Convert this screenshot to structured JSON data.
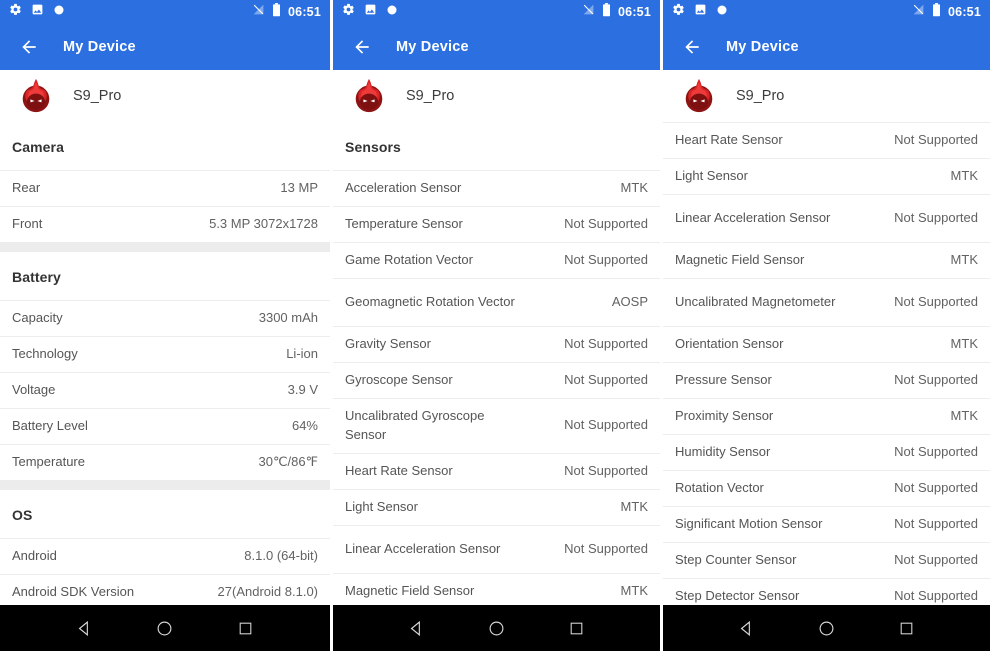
{
  "statusbar": {
    "icons": [
      "gear-icon",
      "image-icon",
      "circle-icon"
    ],
    "signal_icon": "signal-off-icon",
    "battery_icon": "battery-icon",
    "time": "06:51"
  },
  "appbar": {
    "back_icon": "back-arrow-icon",
    "title": "My Device"
  },
  "device": {
    "logo_icon": "antutu-logo-icon",
    "name": "S9_Pro"
  },
  "navbar": {
    "back_icon": "nav-back-triangle-icon",
    "home_icon": "nav-home-circle-icon",
    "recents_icon": "nav-recents-square-icon"
  },
  "colors": {
    "accent_blue": "#2B6FE0",
    "band_gray": "#ececec",
    "divider": "#ededed",
    "label": "#555555",
    "value": "#626262",
    "navbar_black": "#000000"
  },
  "panel1": {
    "sections": [
      {
        "title": "Camera",
        "band_before": false,
        "rows": [
          {
            "label": "Rear",
            "value": "13 MP"
          },
          {
            "label": "Front",
            "value": "5.3 MP 3072x1728"
          }
        ]
      },
      {
        "title": "Battery",
        "band_before": true,
        "rows": [
          {
            "label": "Capacity",
            "value": "3300 mAh"
          },
          {
            "label": "Technology",
            "value": "Li-ion"
          },
          {
            "label": "Voltage",
            "value": "3.9 V"
          },
          {
            "label": "Battery Level",
            "value": "64%"
          },
          {
            "label": "Temperature",
            "value": "30℃/86℉"
          }
        ]
      },
      {
        "title": "OS",
        "band_before": true,
        "rows": [
          {
            "label": "Android",
            "value": "8.1.0 (64-bit)"
          },
          {
            "label": "Android SDK Version",
            "value": "27(Android 8.1.0)"
          }
        ]
      }
    ]
  },
  "panel2": {
    "sections": [
      {
        "title": "Sensors",
        "band_before": false,
        "rows": [
          {
            "label": "Acceleration Sensor",
            "value": "MTK"
          },
          {
            "label": "Temperature Sensor",
            "value": "Not Supported"
          },
          {
            "label": "Game Rotation Vector",
            "value": "Not Supported"
          },
          {
            "label": "Geomagnetic Rotation Vector",
            "value": "AOSP",
            "tall": true
          },
          {
            "label": "Gravity Sensor",
            "value": "Not Supported"
          },
          {
            "label": "Gyroscope Sensor",
            "value": "Not Supported"
          },
          {
            "label": "Uncalibrated Gyroscope Sensor",
            "value": "Not Supported",
            "tall": true
          },
          {
            "label": "Heart Rate Sensor",
            "value": "Not Supported"
          },
          {
            "label": "Light Sensor",
            "value": "MTK"
          },
          {
            "label": "Linear Acceleration Sensor",
            "value": "Not Supported",
            "tall": true
          },
          {
            "label": "Magnetic Field Sensor",
            "value": "MTK"
          }
        ]
      }
    ]
  },
  "panel3": {
    "sections": [
      {
        "title": "",
        "band_before": false,
        "rows": [
          {
            "label": "Heart Rate Sensor",
            "value": "Not Supported"
          },
          {
            "label": "Light Sensor",
            "value": "MTK"
          },
          {
            "label": "Linear Acceleration Sensor",
            "value": "Not Supported",
            "tall": true
          },
          {
            "label": "Magnetic Field Sensor",
            "value": "MTK"
          },
          {
            "label": "Uncalibrated Magnetometer",
            "value": "Not Supported",
            "tall": true
          },
          {
            "label": "Orientation Sensor",
            "value": "MTK"
          },
          {
            "label": "Pressure Sensor",
            "value": "Not Supported"
          },
          {
            "label": "Proximity Sensor",
            "value": "MTK"
          },
          {
            "label": "Humidity Sensor",
            "value": "Not Supported"
          },
          {
            "label": "Rotation Vector",
            "value": "Not Supported"
          },
          {
            "label": "Significant Motion Sensor",
            "value": "Not Supported"
          },
          {
            "label": "Step Counter Sensor",
            "value": "Not Supported"
          },
          {
            "label": "Step Detector Sensor",
            "value": "Not Supported"
          }
        ]
      }
    ]
  }
}
